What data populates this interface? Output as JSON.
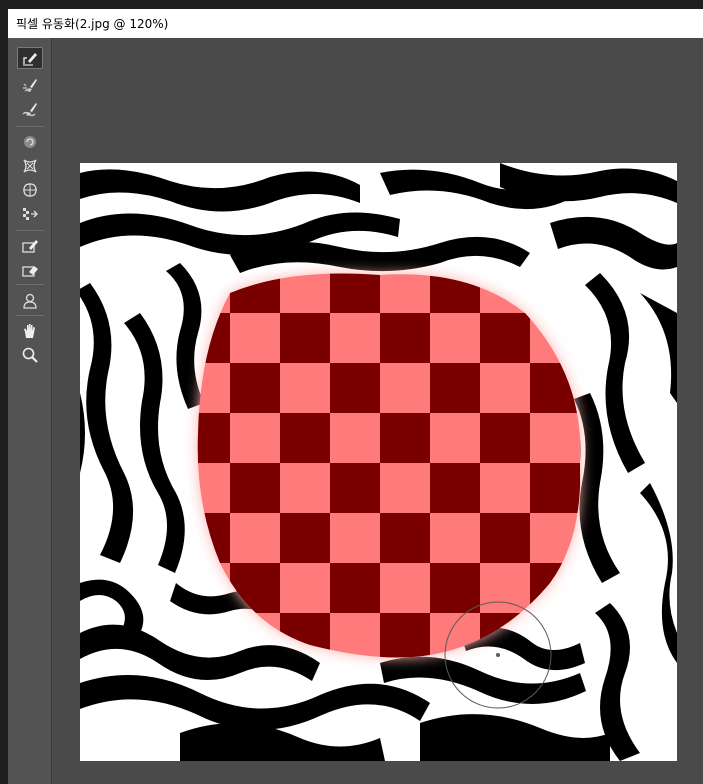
{
  "window": {
    "title": "픽셀 유동화(2.jpg @ 120%)"
  },
  "toolbar": {
    "tools": [
      {
        "name": "forward-warp-tool",
        "active": true
      },
      {
        "name": "reconstruct-tool"
      },
      {
        "name": "smooth-tool"
      },
      {
        "name": "twirl-clockwise-tool"
      },
      {
        "name": "pucker-tool"
      },
      {
        "name": "bloat-tool"
      },
      {
        "name": "push-left-tool"
      },
      {
        "name": "freeze-mask-tool"
      },
      {
        "name": "thaw-mask-tool"
      },
      {
        "name": "face-tool"
      },
      {
        "name": "hand-tool"
      },
      {
        "name": "zoom-tool"
      }
    ]
  },
  "colors": {
    "workspace": "#4a4a4a",
    "toolbar": "#535353",
    "freeze_mask_light": "#ff7a7a",
    "freeze_mask_dark": "#7a0000"
  }
}
